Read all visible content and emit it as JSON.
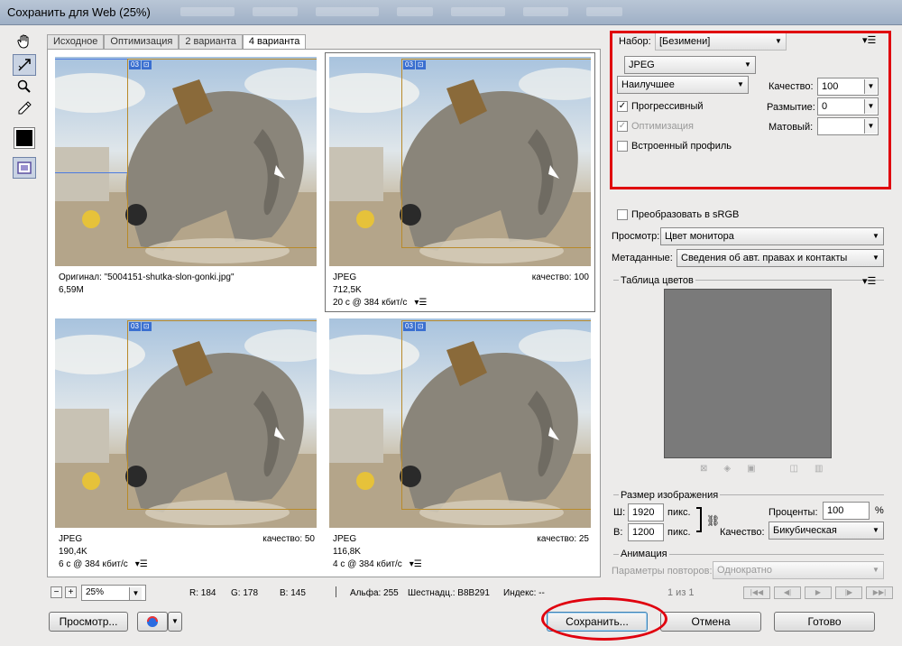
{
  "window": {
    "title": "Сохранить для Web (25%)"
  },
  "tools": [
    {
      "name": "hand-icon"
    },
    {
      "name": "slice-select-icon"
    },
    {
      "name": "zoom-icon"
    },
    {
      "name": "eyedropper-icon"
    }
  ],
  "tabs": [
    "Исходное",
    "Оптимизация",
    "2 варианта",
    "4 варианта"
  ],
  "active_tab": "4 варианта",
  "panes": [
    {
      "line1": "Оригинал: \"5004151-shutka-slon-gonki.jpg\"",
      "line2": "6,59M",
      "line3": "",
      "quality": ""
    },
    {
      "line1": "JPEG",
      "line2": "712,5K",
      "line3": "20 с @ 384 кбит/с",
      "quality": "качество: 100"
    },
    {
      "line1": "JPEG",
      "line2": "190,4K",
      "line3": "6 с @ 384 кбит/с",
      "quality": "качество: 50"
    },
    {
      "line1": "JPEG",
      "line2": "116,8K",
      "line3": "4 с @ 384 кбит/с",
      "quality": "качество: 25"
    }
  ],
  "slice_badge": "03",
  "status": {
    "zoom": "25%",
    "r": "R: 184",
    "g": "G: 178",
    "b": "B: 145",
    "alpha": "Альфа: 255",
    "hex": "Шестнадц.: B8B291",
    "index": "Индекс: --"
  },
  "buttons": {
    "preview": "Просмотр...",
    "save": "Сохранить...",
    "cancel": "Отмена",
    "done": "Готово"
  },
  "settings": {
    "preset_label": "Набор:",
    "preset_value": "[Безимени]",
    "format": "JPEG",
    "compression": "Наилучшее",
    "quality_label": "Качество:",
    "quality_value": "100",
    "progressive": "Прогрессивный",
    "blur_label": "Размытие:",
    "blur_value": "0",
    "optimization": "Оптимизация",
    "matte_label": "Матовый:",
    "embedded_profile": "Встроенный профиль",
    "convert_srgb": "Преобразовать в sRGB",
    "preview_label": "Просмотр:",
    "preview_value": "Цвет монитора",
    "metadata_label": "Метаданные:",
    "metadata_value": "Сведения об авт. правах и контакты"
  },
  "color_table": {
    "title": "Таблица цветов"
  },
  "image_size": {
    "title": "Размер изображения",
    "w_label": "Ш:",
    "w_value": "1920",
    "w_unit": "пикс.",
    "h_label": "В:",
    "h_value": "1200",
    "h_unit": "пикс.",
    "percent_label": "Проценты:",
    "percent_value": "100",
    "percent_unit": "%",
    "quality_label": "Качество:",
    "quality_value": "Бикубическая"
  },
  "animation": {
    "title": "Анимация",
    "loop_label": "Параметры повторов:",
    "loop_value": "Однократно",
    "frame": "1 из 1"
  },
  "colors": {
    "highlight": "#e0000e",
    "slice_blue": "#3a6fd0",
    "slice_border": "#b88a2a"
  }
}
